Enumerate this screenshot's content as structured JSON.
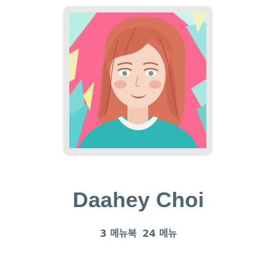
{
  "profile": {
    "name": "Daahey Choi",
    "stats": [
      {
        "count": "3",
        "label": "메뉴북"
      },
      {
        "count": "24",
        "label": "메뉴"
      }
    ]
  },
  "colors": {
    "name_text": "#4f6471",
    "stats_text": "#556a76",
    "frame": "#e6e8ea",
    "avatar_background": "#fa6a92"
  },
  "icons": {
    "avatar": "illustrated-portrait"
  }
}
